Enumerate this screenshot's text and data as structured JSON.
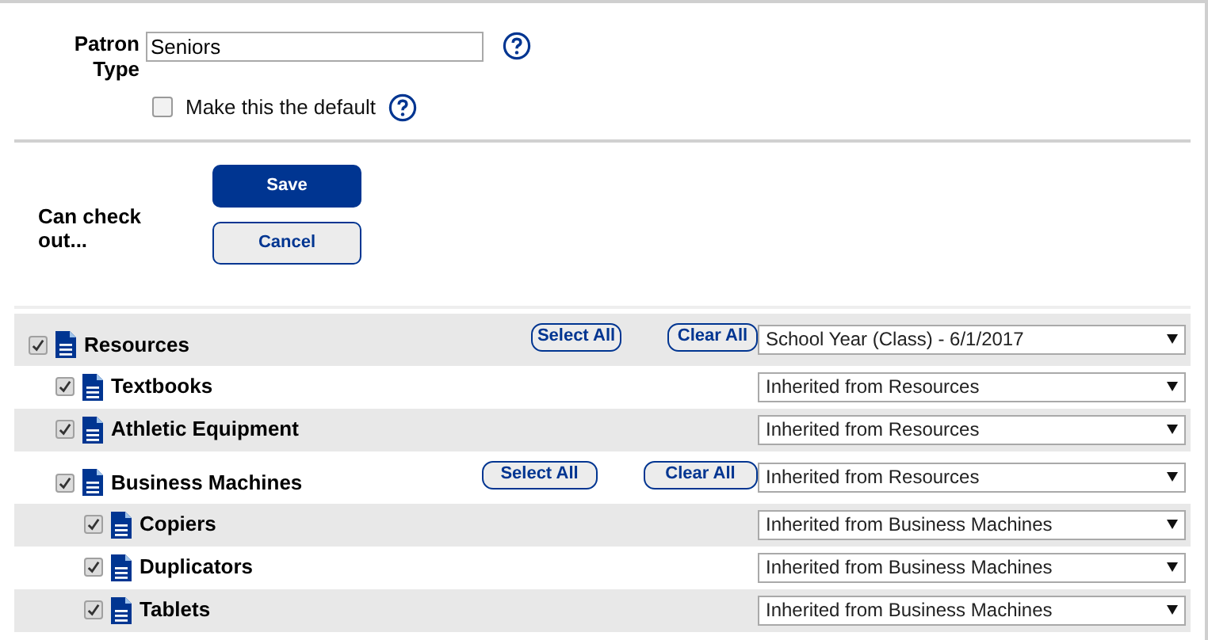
{
  "patron_type": {
    "label": "Patron Type",
    "value": "Seniors"
  },
  "default_option": {
    "label": "Make this the default",
    "checked": false
  },
  "checkout": {
    "label": "Can check out...",
    "buttons": [
      "Save",
      "Cancel"
    ]
  },
  "tree": [
    {
      "name": "Resources",
      "checked": true,
      "buttons": [
        "Select All",
        "Clear All"
      ],
      "period": "School Year (Class) - 6/1/2017",
      "children": [
        {
          "name": "Textbooks",
          "checked": true,
          "period": "Inherited from Resources"
        },
        {
          "name": "Athletic Equipment",
          "checked": true,
          "period": "Inherited from Resources"
        },
        {
          "name": "Business Machines",
          "checked": true,
          "buttons": [
            "Select All",
            "Clear All"
          ],
          "period": "Inherited from Resources",
          "children": [
            {
              "name": "Copiers",
              "checked": true,
              "period": "Inherited from Business Machines"
            },
            {
              "name": "Duplicators",
              "checked": true,
              "period": "Inherited from Business Machines"
            },
            {
              "name": "Tablets",
              "checked": true,
              "period": "Inherited from Business Machines"
            }
          ]
        }
      ]
    }
  ]
}
